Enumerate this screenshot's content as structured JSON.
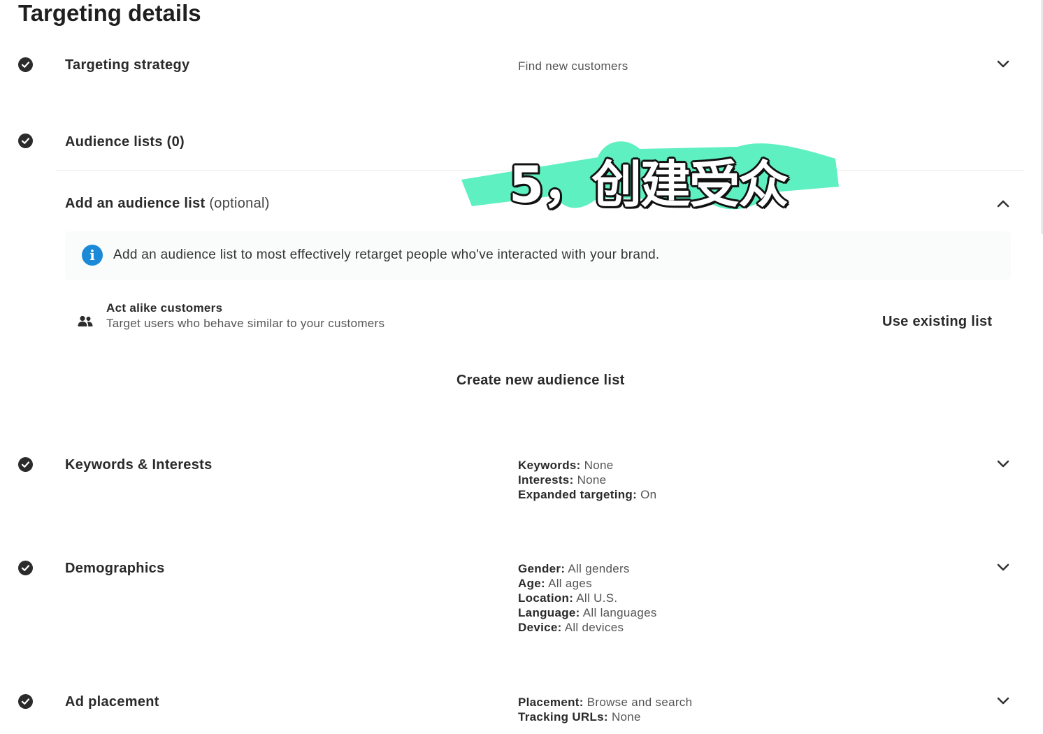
{
  "page_title": "Targeting details",
  "overlay_caption": "5，创建受众",
  "sections": {
    "targeting_strategy": {
      "title": "Targeting strategy",
      "summary": "Find new customers"
    },
    "audience_lists": {
      "title": "Audience lists (0)"
    },
    "add_audience": {
      "title": "Add an audience list",
      "optional": "(optional)",
      "info": "Add an audience list to most effectively retarget people who've interacted with your brand.",
      "act_alike_title": "Act alike customers",
      "act_alike_desc": "Target users who behave similar to your customers",
      "use_existing": "Use existing list",
      "create_new": "Create new audience list"
    },
    "keywords": {
      "title": "Keywords & Interests",
      "rows": [
        {
          "label": "Keywords:",
          "value": "None"
        },
        {
          "label": "Interests:",
          "value": "None"
        },
        {
          "label": "Expanded targeting:",
          "value": "On"
        }
      ]
    },
    "demographics": {
      "title": "Demographics",
      "rows": [
        {
          "label": "Gender:",
          "value": "All genders"
        },
        {
          "label": "Age:",
          "value": "All ages"
        },
        {
          "label": "Location:",
          "value": "All U.S."
        },
        {
          "label": "Language:",
          "value": "All languages"
        },
        {
          "label": "Device:",
          "value": "All devices"
        }
      ]
    },
    "ad_placement": {
      "title": "Ad placement",
      "rows": [
        {
          "label": "Placement:",
          "value": "Browse and search"
        },
        {
          "label": "Tracking URLs:",
          "value": "None"
        }
      ]
    }
  },
  "icons": {
    "check": "check-circle-icon",
    "chevron_down": "chevron-down-icon",
    "chevron_up": "chevron-up-icon",
    "info": "info-icon",
    "people": "people-icon"
  },
  "colors": {
    "info_blue": "#1a8ad8",
    "overlay_green": "#5ef0c0"
  }
}
